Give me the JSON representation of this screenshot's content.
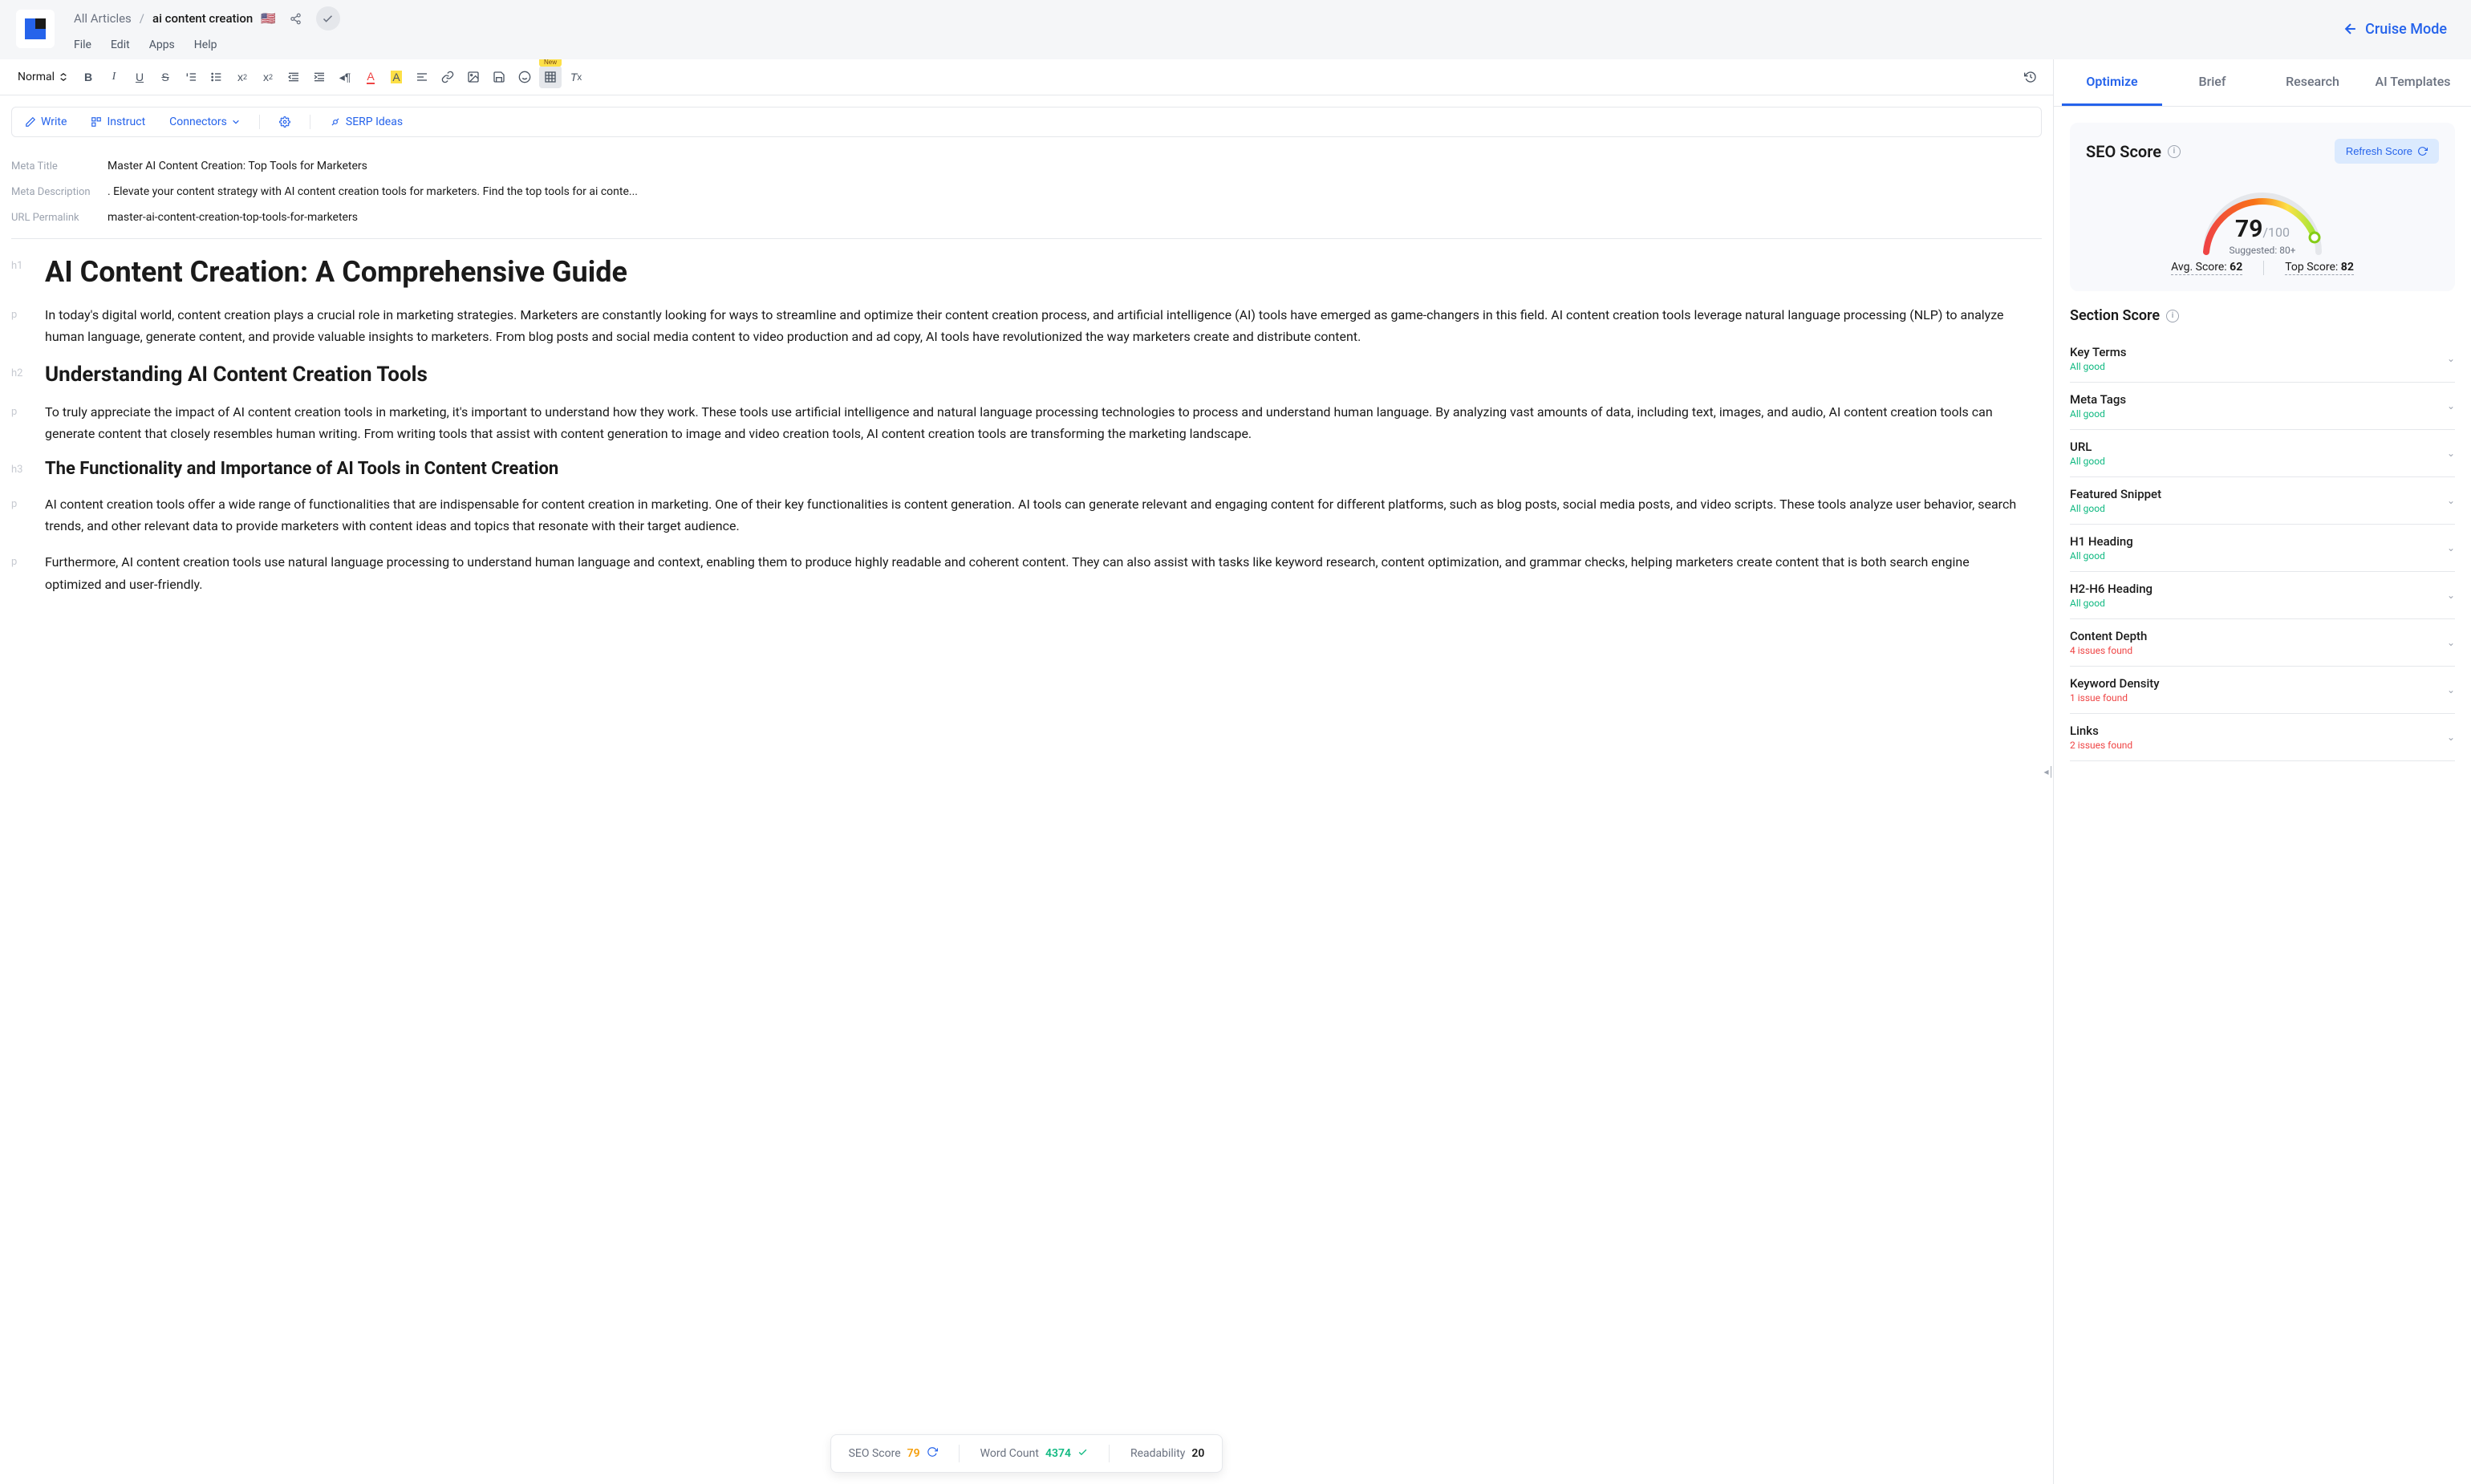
{
  "header": {
    "breadcrumb_all": "All Articles",
    "breadcrumb_current": "ai content creation",
    "flag": "🇺🇸",
    "menu": [
      "File",
      "Edit",
      "Apps",
      "Help"
    ],
    "cruise_label": "Cruise Mode"
  },
  "toolbar": {
    "style_select": "Normal",
    "new_badge": "New"
  },
  "actionbar": {
    "write": "Write",
    "instruct": "Instruct",
    "connectors": "Connectors",
    "serp": "SERP Ideas"
  },
  "meta": {
    "title_label": "Meta Title",
    "title_value": "Master AI Content Creation: Top Tools for Marketers",
    "desc_label": "Meta Description",
    "desc_value": ". Elevate your content strategy with AI content creation tools for marketers. Find the top tools for ai conte...",
    "url_label": "URL Permalink",
    "url_value": "master-ai-content-creation-top-tools-for-marketers"
  },
  "doc": {
    "h1": "AI Content Creation: A Comprehensive Guide",
    "p1": "In today's digital world, content creation plays a crucial role in marketing strategies. Marketers are constantly looking for ways to streamline and optimize their content creation process, and artificial intelligence (AI) tools have emerged as game-changers in this field. AI content creation tools leverage natural language processing (NLP) to analyze human language, generate content, and provide valuable insights to marketers. From blog posts and social media content to video production and ad copy, AI tools have revolutionized the way marketers create and distribute content.",
    "h2": "Understanding AI Content Creation Tools",
    "p2": "To truly appreciate the impact of AI content creation tools in marketing, it's important to understand how they work. These tools use artificial intelligence and natural language processing technologies to process and understand human language. By analyzing vast amounts of data, including text, images, and audio, AI content creation tools can generate content that closely resembles human writing. From writing tools that assist with content generation to image and video creation tools, AI content creation tools are transforming the marketing landscape.",
    "h3": "The Functionality and Importance of AI Tools in Content Creation",
    "p3": "AI content creation tools offer a wide range of functionalities that are indispensable for content creation in marketing. One of their key functionalities is content generation. AI tools can generate relevant and engaging content for different platforms, such as blog posts, social media posts, and video scripts. These tools analyze user behavior, search trends, and other relevant data to provide marketers with content ideas and topics that resonate with their target audience.",
    "p4": " Furthermore, AI content creation tools use natural language processing to understand human language and context, enabling them to produce highly readable and coherent content. They can also assist with tasks like keyword research, content optimization, and grammar checks, helping marketers create content that is both search engine optimized and user-friendly."
  },
  "statusbar": {
    "seo_label": "SEO Score",
    "seo_value": "79",
    "wc_label": "Word Count",
    "wc_value": "4374",
    "read_label": "Readability",
    "read_value": "20"
  },
  "side_tabs": [
    "Optimize",
    "Brief",
    "Research",
    "AI Templates"
  ],
  "seo": {
    "title": "SEO Score",
    "refresh": "Refresh Score",
    "score": "79",
    "max": "/100",
    "suggested": "Suggested: 80+",
    "avg_label": "Avg. Score: ",
    "avg_val": "62",
    "top_label": "Top Score: ",
    "top_val": "82"
  },
  "sections": {
    "title": "Section Score",
    "items": [
      {
        "name": "Key Terms",
        "status": "All good",
        "type": "good"
      },
      {
        "name": "Meta Tags",
        "status": "All good",
        "type": "good"
      },
      {
        "name": "URL",
        "status": "All good",
        "type": "good"
      },
      {
        "name": "Featured Snippet",
        "status": "All good",
        "type": "good"
      },
      {
        "name": "H1 Heading",
        "status": "All good",
        "type": "good"
      },
      {
        "name": "H2-H6 Heading",
        "status": "All good",
        "type": "good"
      },
      {
        "name": "Content Depth",
        "status": "4 issues found",
        "type": "warn"
      },
      {
        "name": "Keyword Density",
        "status": "1 issue found",
        "type": "warn"
      },
      {
        "name": "Links",
        "status": "2 issues found",
        "type": "warn"
      }
    ]
  }
}
